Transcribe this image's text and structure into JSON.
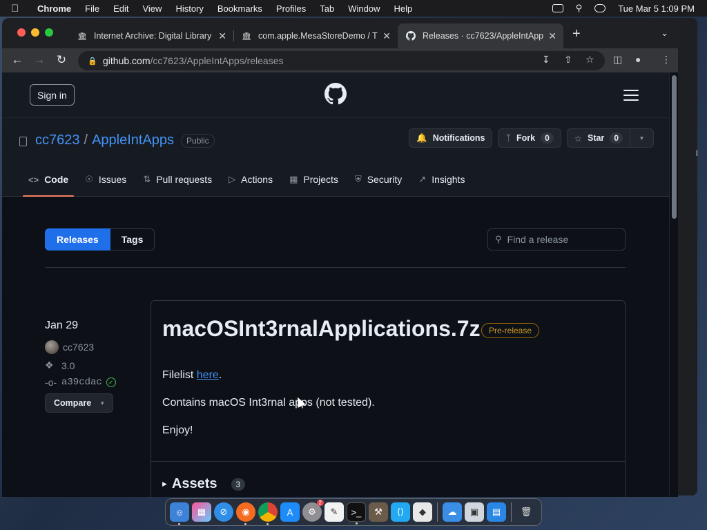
{
  "menubar": {
    "app": "Chrome",
    "items": [
      "File",
      "Edit",
      "View",
      "History",
      "Bookmarks",
      "Profiles",
      "Tab",
      "Window",
      "Help"
    ],
    "clock": "Tue Mar 5  1:09 PM"
  },
  "browser": {
    "tabs": [
      {
        "title": "Internet Archive: Digital Library",
        "icon": "archive-icon"
      },
      {
        "title": "com.apple.MesaStoreDemo / T",
        "icon": "archive-icon"
      },
      {
        "title": "Releases · cc7623/AppleIntApps",
        "icon": "github-icon"
      }
    ],
    "url_host": "github.com",
    "url_path": "/cc7623/AppleIntApps/releases"
  },
  "header": {
    "signin": "Sign in"
  },
  "repo": {
    "owner": "cc7623",
    "separator": "/",
    "name": "AppleIntApps",
    "visibility": "Public",
    "notifications": "Notifications",
    "fork_label": "Fork",
    "fork_count": "0",
    "star_label": "Star",
    "star_count": "0",
    "nav": [
      {
        "label": "Code",
        "icon": "code-icon"
      },
      {
        "label": "Issues",
        "icon": "issue-icon"
      },
      {
        "label": "Pull requests",
        "icon": "pull-request-icon"
      },
      {
        "label": "Actions",
        "icon": "play-icon"
      },
      {
        "label": "Projects",
        "icon": "table-icon"
      },
      {
        "label": "Security",
        "icon": "shield-icon"
      },
      {
        "label": "Insights",
        "icon": "graph-icon"
      }
    ]
  },
  "releases_nav": {
    "releases": "Releases",
    "tags": "Tags",
    "search_placeholder": "Find a release"
  },
  "release": {
    "date": "Jan 29",
    "author": "cc7623",
    "tag": "3.0",
    "commit": "a39cdac",
    "compare": "Compare",
    "title": "macOSInt3rnalApplications.7z",
    "badge": "Pre-release",
    "body_prefix": "Filelist ",
    "body_link": "here",
    "body_suffix": ".",
    "body_line2": "Contains macOS Int3rnal apps (not tested).",
    "body_line3": "Enjoy!",
    "assets_label": "Assets",
    "assets_count": "3"
  },
  "colors": {
    "accent": "#1f6feb",
    "link": "#4493f8",
    "prerelease": "#d29922",
    "active_underline": "#f78166"
  },
  "dock": {
    "apps": [
      "finder-icon",
      "launchpad-icon",
      "safari-icon",
      "firefox-icon",
      "chrome-icon",
      "app-store-icon",
      "system-settings-icon",
      "textedit-icon",
      "terminal-icon",
      "instruments-icon",
      "vscode-icon",
      "roblox-icon",
      "icloud-icon",
      "preview-icon",
      "keynote-icon",
      "trash-icon"
    ],
    "settings_badge": "2"
  }
}
